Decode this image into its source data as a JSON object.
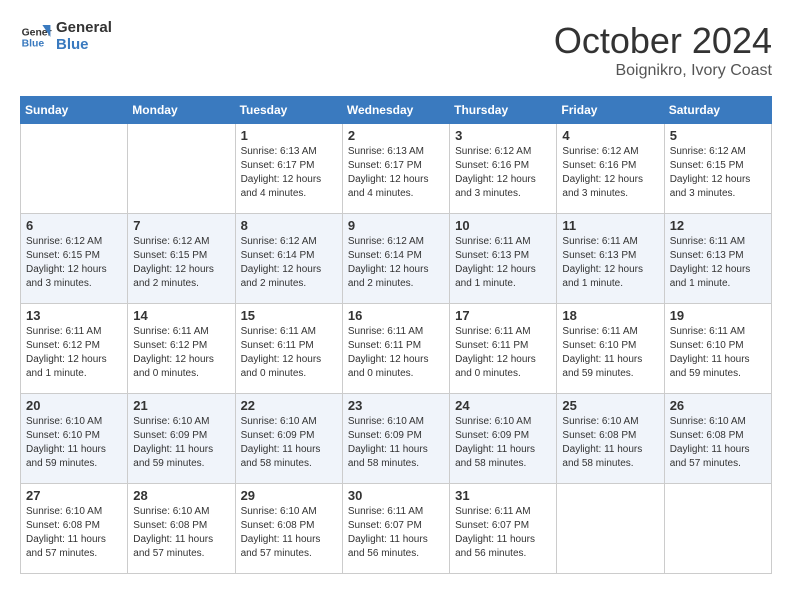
{
  "logo": {
    "line1": "General",
    "line2": "Blue"
  },
  "title": "October 2024",
  "location": "Boignikro, Ivory Coast",
  "weekdays": [
    "Sunday",
    "Monday",
    "Tuesday",
    "Wednesday",
    "Thursday",
    "Friday",
    "Saturday"
  ],
  "weeks": [
    [
      {
        "day": "",
        "info": ""
      },
      {
        "day": "",
        "info": ""
      },
      {
        "day": "1",
        "info": "Sunrise: 6:13 AM\nSunset: 6:17 PM\nDaylight: 12 hours\nand 4 minutes."
      },
      {
        "day": "2",
        "info": "Sunrise: 6:13 AM\nSunset: 6:17 PM\nDaylight: 12 hours\nand 4 minutes."
      },
      {
        "day": "3",
        "info": "Sunrise: 6:12 AM\nSunset: 6:16 PM\nDaylight: 12 hours\nand 3 minutes."
      },
      {
        "day": "4",
        "info": "Sunrise: 6:12 AM\nSunset: 6:16 PM\nDaylight: 12 hours\nand 3 minutes."
      },
      {
        "day": "5",
        "info": "Sunrise: 6:12 AM\nSunset: 6:15 PM\nDaylight: 12 hours\nand 3 minutes."
      }
    ],
    [
      {
        "day": "6",
        "info": "Sunrise: 6:12 AM\nSunset: 6:15 PM\nDaylight: 12 hours\nand 3 minutes."
      },
      {
        "day": "7",
        "info": "Sunrise: 6:12 AM\nSunset: 6:15 PM\nDaylight: 12 hours\nand 2 minutes."
      },
      {
        "day": "8",
        "info": "Sunrise: 6:12 AM\nSunset: 6:14 PM\nDaylight: 12 hours\nand 2 minutes."
      },
      {
        "day": "9",
        "info": "Sunrise: 6:12 AM\nSunset: 6:14 PM\nDaylight: 12 hours\nand 2 minutes."
      },
      {
        "day": "10",
        "info": "Sunrise: 6:11 AM\nSunset: 6:13 PM\nDaylight: 12 hours\nand 1 minute."
      },
      {
        "day": "11",
        "info": "Sunrise: 6:11 AM\nSunset: 6:13 PM\nDaylight: 12 hours\nand 1 minute."
      },
      {
        "day": "12",
        "info": "Sunrise: 6:11 AM\nSunset: 6:13 PM\nDaylight: 12 hours\nand 1 minute."
      }
    ],
    [
      {
        "day": "13",
        "info": "Sunrise: 6:11 AM\nSunset: 6:12 PM\nDaylight: 12 hours\nand 1 minute."
      },
      {
        "day": "14",
        "info": "Sunrise: 6:11 AM\nSunset: 6:12 PM\nDaylight: 12 hours\nand 0 minutes."
      },
      {
        "day": "15",
        "info": "Sunrise: 6:11 AM\nSunset: 6:11 PM\nDaylight: 12 hours\nand 0 minutes."
      },
      {
        "day": "16",
        "info": "Sunrise: 6:11 AM\nSunset: 6:11 PM\nDaylight: 12 hours\nand 0 minutes."
      },
      {
        "day": "17",
        "info": "Sunrise: 6:11 AM\nSunset: 6:11 PM\nDaylight: 12 hours\nand 0 minutes."
      },
      {
        "day": "18",
        "info": "Sunrise: 6:11 AM\nSunset: 6:10 PM\nDaylight: 11 hours\nand 59 minutes."
      },
      {
        "day": "19",
        "info": "Sunrise: 6:11 AM\nSunset: 6:10 PM\nDaylight: 11 hours\nand 59 minutes."
      }
    ],
    [
      {
        "day": "20",
        "info": "Sunrise: 6:10 AM\nSunset: 6:10 PM\nDaylight: 11 hours\nand 59 minutes."
      },
      {
        "day": "21",
        "info": "Sunrise: 6:10 AM\nSunset: 6:09 PM\nDaylight: 11 hours\nand 59 minutes."
      },
      {
        "day": "22",
        "info": "Sunrise: 6:10 AM\nSunset: 6:09 PM\nDaylight: 11 hours\nand 58 minutes."
      },
      {
        "day": "23",
        "info": "Sunrise: 6:10 AM\nSunset: 6:09 PM\nDaylight: 11 hours\nand 58 minutes."
      },
      {
        "day": "24",
        "info": "Sunrise: 6:10 AM\nSunset: 6:09 PM\nDaylight: 11 hours\nand 58 minutes."
      },
      {
        "day": "25",
        "info": "Sunrise: 6:10 AM\nSunset: 6:08 PM\nDaylight: 11 hours\nand 58 minutes."
      },
      {
        "day": "26",
        "info": "Sunrise: 6:10 AM\nSunset: 6:08 PM\nDaylight: 11 hours\nand 57 minutes."
      }
    ],
    [
      {
        "day": "27",
        "info": "Sunrise: 6:10 AM\nSunset: 6:08 PM\nDaylight: 11 hours\nand 57 minutes."
      },
      {
        "day": "28",
        "info": "Sunrise: 6:10 AM\nSunset: 6:08 PM\nDaylight: 11 hours\nand 57 minutes."
      },
      {
        "day": "29",
        "info": "Sunrise: 6:10 AM\nSunset: 6:08 PM\nDaylight: 11 hours\nand 57 minutes."
      },
      {
        "day": "30",
        "info": "Sunrise: 6:11 AM\nSunset: 6:07 PM\nDaylight: 11 hours\nand 56 minutes."
      },
      {
        "day": "31",
        "info": "Sunrise: 6:11 AM\nSunset: 6:07 PM\nDaylight: 11 hours\nand 56 minutes."
      },
      {
        "day": "",
        "info": ""
      },
      {
        "day": "",
        "info": ""
      }
    ]
  ]
}
